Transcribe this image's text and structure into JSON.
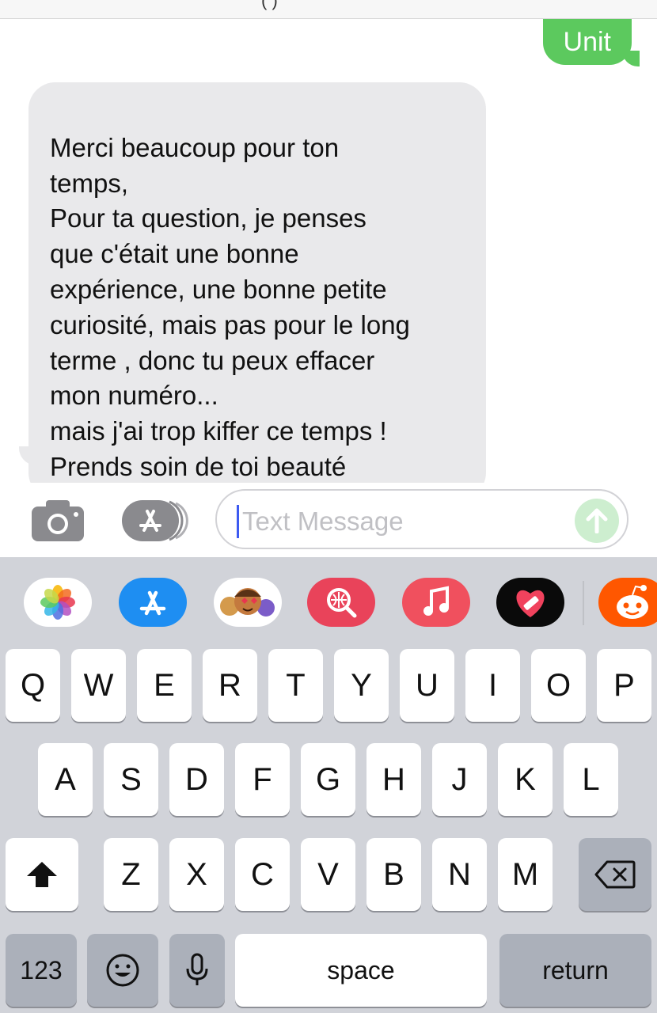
{
  "header": {
    "title_fragment": "(⁠ ⁠)"
  },
  "conversation": {
    "sent": [
      {
        "text": "Unit"
      }
    ],
    "received": [
      {
        "text": "Merci beaucoup pour ton\ntemps,\nPour ta question, je penses\nque c'était une bonne\nexpérience, une bonne petite\ncuriosité, mais pas pour le long\nterme , donc tu peux effacer\nmon numéro...\nmais j'ai trop kiffer ce temps !\nPrends soin de toi beauté"
      }
    ]
  },
  "composer": {
    "placeholder": "Text Message",
    "camera_icon": "camera-icon",
    "apps_icon": "app-store-icon",
    "send_icon": "arrow-up-icon"
  },
  "app_drawer": {
    "apps": [
      {
        "name": "photos-app-icon"
      },
      {
        "name": "app-store-app-icon"
      },
      {
        "name": "memoji-app-icon"
      },
      {
        "name": "images-search-app-icon"
      },
      {
        "name": "music-app-icon"
      },
      {
        "name": "digital-touch-app-icon"
      },
      {
        "name": "reddit-app-icon"
      }
    ]
  },
  "keyboard": {
    "row1": [
      "Q",
      "W",
      "E",
      "R",
      "T",
      "Y",
      "U",
      "I",
      "O",
      "P"
    ],
    "row2": [
      "A",
      "S",
      "D",
      "F",
      "G",
      "H",
      "J",
      "K",
      "L"
    ],
    "row3": [
      "Z",
      "X",
      "C",
      "V",
      "B",
      "N",
      "M"
    ],
    "numbers_label": "123",
    "space_label": "space",
    "return_label": "return",
    "shift_icon": "shift-icon",
    "delete_icon": "delete-icon",
    "emoji_icon": "emoji-icon",
    "mic_icon": "microphone-icon"
  },
  "colors": {
    "sent_bubble": "#5cc95e",
    "received_bubble": "#e9e9eb",
    "keyboard_bg": "#d1d3d9",
    "caret": "#3d5af1"
  }
}
